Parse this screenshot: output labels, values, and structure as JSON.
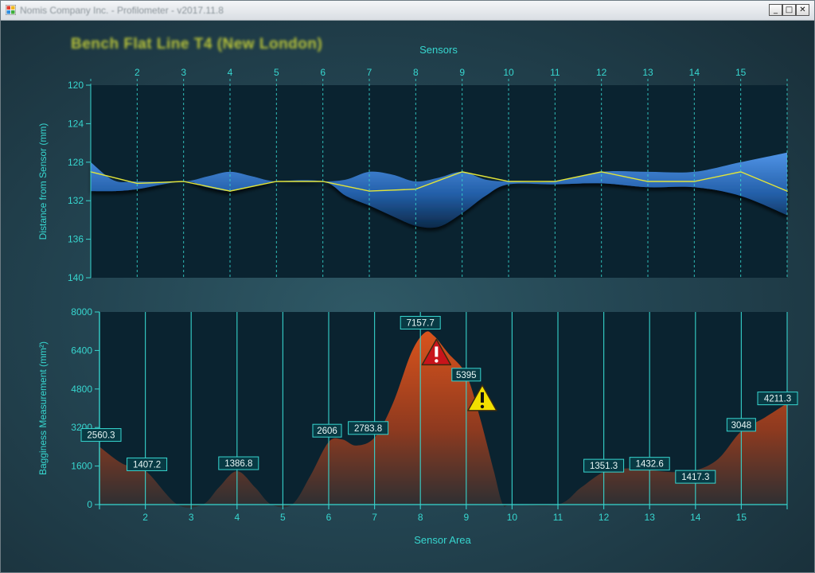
{
  "window": {
    "title": "Nomis Company Inc. - Profilometer - v2017.11.8",
    "minimize_glyph": "_",
    "maximize_glyph": "□",
    "close_glyph": "✕",
    "app_icon": "application-icon"
  },
  "header": {
    "line_title": "Bench Flat Line T4 (New London)"
  },
  "colors": {
    "accent": "#37d6cf",
    "distance_fill": "#2e6fc4",
    "distance_line": "#e1e43a",
    "bagginess_fill": "#c04a1e",
    "alarm_red": "#c8141b",
    "warning_yellow": "#f2e000",
    "label_bg": "#083a44"
  },
  "chart_data": [
    {
      "type": "area",
      "title": "Sensors",
      "ylabel": "Distance from Sensor (mm)",
      "ylim": [
        140,
        120
      ],
      "y_inverted": true,
      "y_ticks": [
        "120",
        "124",
        "128",
        "132",
        "136",
        "140"
      ],
      "x_ticks": [
        "2",
        "3",
        "4",
        "5",
        "6",
        "7",
        "8",
        "9",
        "10",
        "11",
        "12",
        "13",
        "14",
        "15"
      ],
      "grid": "vertical dashed",
      "series": [
        {
          "role": "average",
          "x": [
            1,
            2,
            3,
            4,
            5,
            6,
            7,
            8,
            9,
            10,
            11,
            12,
            13,
            14,
            15,
            16
          ],
          "values": [
            129.0,
            130.2,
            130.0,
            131.0,
            130.0,
            130.0,
            131.0,
            130.8,
            129.0,
            130.0,
            130.0,
            129.0,
            130.0,
            130.0,
            129.0,
            131.0
          ]
        },
        {
          "role": "band-upper",
          "x": [
            1,
            1.5,
            2,
            3,
            3.5,
            4,
            4.5,
            5,
            6,
            6.5,
            7,
            7.5,
            8,
            8.5,
            9,
            9.5,
            10,
            11,
            12,
            13,
            14,
            15,
            16
          ],
          "values": [
            128.0,
            129.9,
            130.0,
            130.0,
            129.5,
            129.0,
            129.5,
            130.0,
            130.0,
            129.8,
            129.0,
            129.3,
            130.0,
            129.6,
            129.0,
            129.8,
            130.0,
            130.0,
            129.0,
            129.0,
            129.0,
            128.0,
            127.0
          ]
        },
        {
          "role": "band-lower",
          "x": [
            1,
            1.5,
            2,
            3,
            3.5,
            4,
            4.5,
            5,
            6,
            6.5,
            7,
            7.5,
            8,
            8.5,
            9,
            9.5,
            10,
            11,
            12,
            13,
            14,
            15,
            16
          ],
          "values": [
            131.0,
            131.0,
            130.8,
            130.0,
            130.6,
            131.0,
            130.5,
            130.0,
            130.0,
            131.5,
            132.5,
            133.6,
            134.6,
            134.7,
            133.3,
            131.5,
            130.3,
            130.3,
            130.2,
            130.6,
            130.6,
            131.5,
            133.5
          ]
        }
      ]
    },
    {
      "type": "area",
      "xlabel": "Sensor Area",
      "ylabel": "Bagginess Measurement (mm²)",
      "ylim": [
        0,
        8000
      ],
      "y_ticks": [
        "0",
        "1600",
        "3200",
        "4800",
        "6400",
        "8000"
      ],
      "x_ticks": [
        "2",
        "3",
        "4",
        "5",
        "6",
        "7",
        "8",
        "9",
        "10",
        "11",
        "12",
        "13",
        "14",
        "15"
      ],
      "grid": "vertical",
      "series": [
        {
          "name": "Bagginess",
          "x": [
            1,
            1.5,
            2,
            2.7,
            3.25,
            3.6,
            4,
            4.4,
            4.75,
            5.2,
            5.6,
            6,
            6.3,
            6.6,
            7,
            7.4,
            7.8,
            8.1,
            8.3,
            8.6,
            9,
            9.3,
            9.6,
            9.8,
            10,
            11,
            11.5,
            12,
            12.5,
            13,
            13.5,
            14,
            14.5,
            15,
            15.5,
            16
          ],
          "values": [
            2400,
            1700,
            1407,
            0,
            0,
            700,
            1387,
            700,
            0,
            0,
            1200,
            2606,
            2700,
            2450,
            2784,
            4200,
            6300,
            7150,
            7000,
            6300,
            5395,
            3600,
            1400,
            0,
            0,
            0,
            700,
            1351,
            1500,
            1433,
            1350,
            1417,
            1900,
            3048,
            3600,
            4211
          ]
        }
      ],
      "data_labels": [
        {
          "x": 1,
          "y": 2560.3,
          "text": "2560.3"
        },
        {
          "x": 2,
          "y": 1407.2,
          "text": "1407.2"
        },
        {
          "x": 4,
          "y": 1386.8,
          "text": "1386.8"
        },
        {
          "x": 6,
          "y": 2606,
          "text": "2606"
        },
        {
          "x": 7,
          "y": 2783.8,
          "text": "2783.8"
        },
        {
          "x": 8,
          "y": 7157.7,
          "text": "7157.7"
        },
        {
          "x": 9,
          "y": 5395,
          "text": "5395"
        },
        {
          "x": 12,
          "y": 1351.3,
          "text": "1351.3"
        },
        {
          "x": 13,
          "y": 1432.6,
          "text": "1432.6"
        },
        {
          "x": 14,
          "y": 1417.3,
          "text": "1417.3"
        },
        {
          "x": 15,
          "y": 3048,
          "text": "3048"
        },
        {
          "x": 16,
          "y": 4211.3,
          "text": "4211.3"
        }
      ],
      "markers": [
        {
          "icon": "alarm-icon",
          "level": "critical",
          "x": 8.35,
          "y": 6300
        },
        {
          "icon": "warning-icon",
          "level": "warning",
          "x": 9.35,
          "y": 4400
        }
      ]
    }
  ]
}
